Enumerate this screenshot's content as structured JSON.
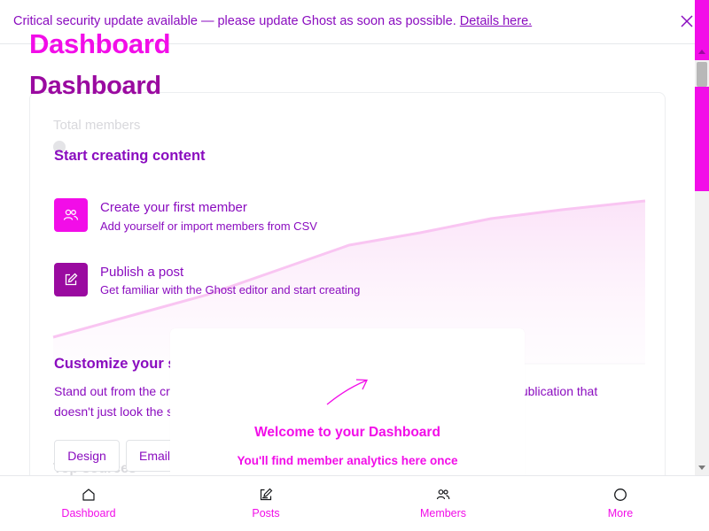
{
  "banner": {
    "message": "Critical security update available — please update Ghost as soon as possible.",
    "link_text": "Details here."
  },
  "headings": {
    "primary": "Dashboard",
    "secondary": "Dashboard"
  },
  "background_card": {
    "label": "Total members",
    "sources_label": "Top sources"
  },
  "start_section": {
    "title": "Start creating content",
    "items": [
      {
        "title": "Create your first member",
        "subtitle": "Add yourself or import members from CSV",
        "icon": "members-icon"
      },
      {
        "title": "Publish a post",
        "subtitle": "Get familiar with the Ghost editor and start creating",
        "icon": "edit-icon"
      }
    ]
  },
  "customize_section": {
    "title": "Customize your site",
    "line1": "Stand out from the crowd. Ghost lets you customize everything so you can create a publication that",
    "line2": "doesn't just look the same as what everyone else has.",
    "buttons": [
      "Design",
      "Email"
    ]
  },
  "welcome": {
    "title": "Welcome to your Dashboard",
    "subtitle": "You'll find member analytics here once"
  },
  "bottom_nav": [
    {
      "label": "Dashboard",
      "icon": "home-icon"
    },
    {
      "label": "Posts",
      "icon": "posts-icon"
    },
    {
      "label": "Members",
      "icon": "members-icon"
    },
    {
      "label": "More",
      "icon": "more-icon"
    }
  ],
  "colors": {
    "accent": "#8a0cbf",
    "highlight": "#f20de8",
    "icon_bg_pink": "#f20de8",
    "icon_bg_purple": "#9a0aa0"
  }
}
